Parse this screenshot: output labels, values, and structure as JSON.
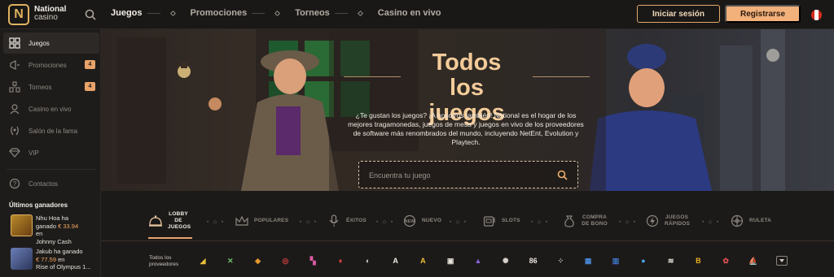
{
  "brand": {
    "name": "National",
    "sub": "casino",
    "logo_letter": "N",
    "accent": "#e0b260"
  },
  "topnav": {
    "items": [
      {
        "label": "Juegos",
        "active": true
      },
      {
        "label": "Promociones",
        "active": false
      },
      {
        "label": "Torneos",
        "active": false
      },
      {
        "label": "Casino en vivo",
        "active": false
      }
    ],
    "login_label": "Iniciar sesión",
    "register_label": "Registrarse",
    "flag": "peru-flag-icon"
  },
  "sidebar": {
    "items": [
      {
        "label": "Juegos",
        "icon": "games-grid-icon",
        "active": true
      },
      {
        "label": "Promociones",
        "icon": "megaphone-icon",
        "badge": "4"
      },
      {
        "label": "Torneos",
        "icon": "tournament-icon",
        "badge": "4"
      },
      {
        "label": "Casino en vivo",
        "icon": "live-dealer-icon"
      },
      {
        "label": "Salón de la fama",
        "icon": "laurel-icon"
      },
      {
        "label": "VIP",
        "icon": "diamond-icon"
      },
      {
        "label": "Contactos",
        "icon": "help-icon"
      }
    ],
    "winners_title": "Últimos ganadores",
    "winners": [
      {
        "line1": "Nhu Hoa ha",
        "line2_prefix": "ganado ",
        "amount": "€ 33.94",
        "line3": "en",
        "line4": "Johnny Cash"
      },
      {
        "line1": "Jakub ha ganado",
        "line2_prefix": "",
        "amount": "€ 77.59",
        "line3": " en",
        "line4": "Rise of Olympus 1..."
      }
    ]
  },
  "hero": {
    "title": "Todos los juegos",
    "description": "¿Te gustan los juegos? ¡A nosotros también! National es el hogar de los mejores tragamonedas, juegos de mesa y juegos en vivo de los proveedores de software más renombrados del mundo, incluyendo NetEnt, Evolution y Playtech.",
    "search_placeholder": "Encuentra tu juego"
  },
  "categories": [
    {
      "label": "LOBBY DE JUEGOS",
      "icon": "lobby-bell-icon",
      "active": true
    },
    {
      "label": "POPULARES",
      "icon": "crown-icon"
    },
    {
      "label": "ÉXITOS",
      "icon": "microphone-icon"
    },
    {
      "label": "NUEVO",
      "icon": "new-badge-icon"
    },
    {
      "label": "SLOTS",
      "icon": "slot-machine-icon"
    },
    {
      "label": "COMPRA DE BONO",
      "icon": "money-bag-icon"
    },
    {
      "label": "JUEGOS RÁPIDOS",
      "icon": "lightning-icon"
    },
    {
      "label": "RULETA",
      "icon": "roulette-icon"
    }
  ],
  "providers": {
    "label": "Todos los proveedores",
    "items": [
      {
        "name": "provider-1-icon",
        "glyph": "◢",
        "color": "#e6c23a"
      },
      {
        "name": "provider-2-icon",
        "glyph": "✕",
        "color": "#6fc36b"
      },
      {
        "name": "provider-3-icon",
        "glyph": "◆",
        "color": "#e69a2c"
      },
      {
        "name": "provider-4-icon",
        "glyph": "◎",
        "color": "#d64040"
      },
      {
        "name": "provider-5-icon",
        "glyph": "▚",
        "color": "#d85aa0"
      },
      {
        "name": "provider-6-icon",
        "glyph": "♦",
        "color": "#d63b3b"
      },
      {
        "name": "provider-7-icon",
        "glyph": "◐",
        "color": "#d9d4cc"
      },
      {
        "name": "provider-8-icon",
        "glyph": "A",
        "color": "#f1ede6"
      },
      {
        "name": "provider-9-icon",
        "glyph": "A",
        "color": "#f1c232"
      },
      {
        "name": "provider-10-icon",
        "glyph": "▣",
        "color": "#e9e4dc"
      },
      {
        "name": "provider-11-icon",
        "glyph": "▲",
        "color": "#8a62d8"
      },
      {
        "name": "provider-12-icon",
        "glyph": "✺",
        "color": "#d9d4cc"
      },
      {
        "name": "provider-13-icon",
        "glyph": "86",
        "color": "#e9e4dc"
      },
      {
        "name": "provider-14-icon",
        "glyph": "⁘",
        "color": "#cfc9c0"
      },
      {
        "name": "provider-15-icon",
        "glyph": "▦",
        "color": "#4a88d8"
      },
      {
        "name": "provider-16-icon",
        "glyph": "▥",
        "color": "#3f78c8"
      },
      {
        "name": "provider-17-icon",
        "glyph": "●",
        "color": "#45a5e0"
      },
      {
        "name": "provider-18-icon",
        "glyph": "≋",
        "color": "#e9e4dc"
      },
      {
        "name": "provider-19-icon",
        "glyph": "B",
        "color": "#f1b622"
      },
      {
        "name": "provider-20-icon",
        "glyph": "✿",
        "color": "#e05050"
      },
      {
        "name": "provider-21-icon",
        "glyph": "⛵",
        "color": "#5a8ad0"
      }
    ]
  }
}
